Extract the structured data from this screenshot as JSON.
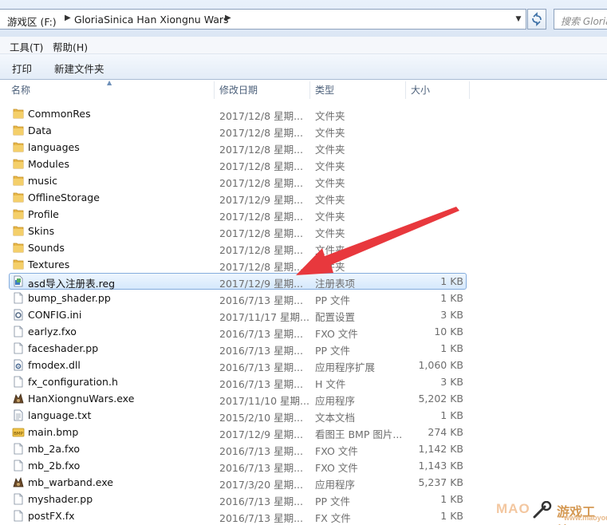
{
  "address_bar": {
    "breadcrumbs": [
      "游戏区 (F:)",
      "GloriaSinica Han Xiongnu Wars"
    ],
    "search_placeholder": "搜索 Gloria"
  },
  "menu": [
    "工具(T)",
    "帮助(H)"
  ],
  "toolbar": [
    "打印",
    "新建文件夹"
  ],
  "columns": [
    "名称",
    "修改日期",
    "类型",
    "大小"
  ],
  "files": [
    {
      "name": "CommonRes",
      "date": "2017/12/8 星期...",
      "type": "文件夹",
      "size": "",
      "icon": "folder-icon"
    },
    {
      "name": "Data",
      "date": "2017/12/8 星期...",
      "type": "文件夹",
      "size": "",
      "icon": "folder-icon"
    },
    {
      "name": "languages",
      "date": "2017/12/8 星期...",
      "type": "文件夹",
      "size": "",
      "icon": "folder-icon"
    },
    {
      "name": "Modules",
      "date": "2017/12/8 星期...",
      "type": "文件夹",
      "size": "",
      "icon": "folder-icon"
    },
    {
      "name": "music",
      "date": "2017/12/8 星期...",
      "type": "文件夹",
      "size": "",
      "icon": "folder-icon"
    },
    {
      "name": "OfflineStorage",
      "date": "2017/12/9 星期...",
      "type": "文件夹",
      "size": "",
      "icon": "folder-icon"
    },
    {
      "name": "Profile",
      "date": "2017/12/8 星期...",
      "type": "文件夹",
      "size": "",
      "icon": "folder-icon"
    },
    {
      "name": "Skins",
      "date": "2017/12/8 星期...",
      "type": "文件夹",
      "size": "",
      "icon": "folder-icon"
    },
    {
      "name": "Sounds",
      "date": "2017/12/8 星期...",
      "type": "文件夹",
      "size": "",
      "icon": "folder-icon"
    },
    {
      "name": "Textures",
      "date": "2017/12/8 星期...",
      "type": "文件夹",
      "size": "",
      "icon": "folder-icon"
    },
    {
      "name": "asd导入注册表.reg",
      "date": "2017/12/9 星期...",
      "type": "注册表项",
      "size": "1 KB",
      "icon": "registry-file-icon",
      "selected": true
    },
    {
      "name": "bump_shader.pp",
      "date": "2016/7/13 星期...",
      "type": "PP 文件",
      "size": "1 KB",
      "icon": "file-icon"
    },
    {
      "name": "CONFIG.ini",
      "date": "2017/11/17 星期...",
      "type": "配置设置",
      "size": "3 KB",
      "icon": "config-file-icon"
    },
    {
      "name": "earlyz.fxo",
      "date": "2016/7/13 星期...",
      "type": "FXO 文件",
      "size": "10 KB",
      "icon": "file-icon"
    },
    {
      "name": "faceshader.pp",
      "date": "2016/7/13 星期...",
      "type": "PP 文件",
      "size": "1 KB",
      "icon": "file-icon"
    },
    {
      "name": "fmodex.dll",
      "date": "2016/7/13 星期...",
      "type": "应用程序扩展",
      "size": "1,060 KB",
      "icon": "dll-file-icon"
    },
    {
      "name": "fx_configuration.h",
      "date": "2016/7/13 星期...",
      "type": "H 文件",
      "size": "3 KB",
      "icon": "file-icon"
    },
    {
      "name": "HanXiongnuWars.exe",
      "date": "2017/11/10 星期...",
      "type": "应用程序",
      "size": "5,202 KB",
      "icon": "exe-icon"
    },
    {
      "name": "language.txt",
      "date": "2015/2/10 星期...",
      "type": "文本文档",
      "size": "1 KB",
      "icon": "text-file-icon"
    },
    {
      "name": "main.bmp",
      "date": "2017/12/9 星期...",
      "type": "看图王 BMP 图片...",
      "size": "274 KB",
      "icon": "bmp-file-icon"
    },
    {
      "name": "mb_2a.fxo",
      "date": "2016/7/13 星期...",
      "type": "FXO 文件",
      "size": "1,142 KB",
      "icon": "file-icon"
    },
    {
      "name": "mb_2b.fxo",
      "date": "2016/7/13 星期...",
      "type": "FXO 文件",
      "size": "1,143 KB",
      "icon": "file-icon"
    },
    {
      "name": "mb_warband.exe",
      "date": "2017/3/20 星期...",
      "type": "应用程序",
      "size": "5,237 KB",
      "icon": "exe-icon"
    },
    {
      "name": "myshader.pp",
      "date": "2016/7/13 星期...",
      "type": "PP 文件",
      "size": "1 KB",
      "icon": "file-icon"
    },
    {
      "name": "postFX.fx",
      "date": "2016/7/13 星期...",
      "type": "FX 文件",
      "size": "1 KB",
      "icon": "file-icon"
    }
  ],
  "watermark": {
    "text_a": "MAO",
    "text_b": "游戏工坊",
    "text_c": "www.maoyou.com"
  },
  "colors": {
    "accent_arrow": "#e8383d",
    "selection_border": "#84acdd",
    "folder": "#e8b84a"
  }
}
